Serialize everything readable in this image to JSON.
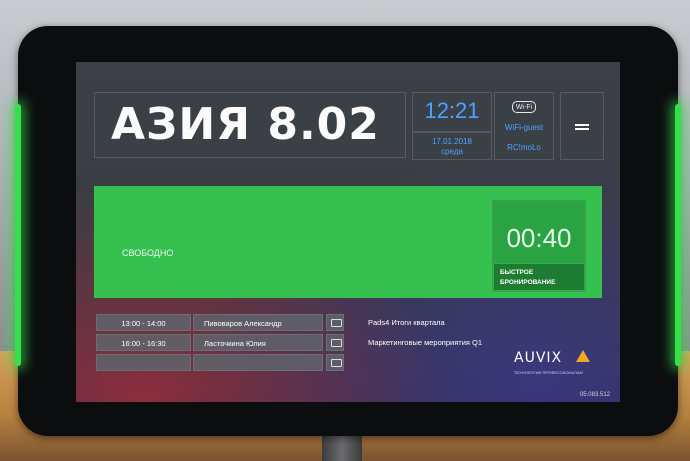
{
  "screen": {
    "room_title": "АЗИЯ 8.02",
    "clock": "12:21",
    "date": "17.01.2018",
    "weekday": "среда",
    "wifi": {
      "icon": "wifi-icon",
      "ssid": "WiFi-guest",
      "password": "RC!moLo"
    },
    "menu_icon": "menu-icon",
    "status": {
      "text": "СВОБОДНО",
      "timer": "00:40",
      "quick_book_line1": "БЫСТРОЕ",
      "quick_book_line2": "БРОНИРОВАНИЕ"
    },
    "meetings": [
      {
        "time": "13:00 - 14:00",
        "person": "Пивоваров Александр",
        "topic": "Pads4 Итоги квартала"
      },
      {
        "time": "16:00 - 16:30",
        "person": "Ласточкина Юлия",
        "topic": "Маркетинговые мероприятия Q1"
      },
      {
        "time": "",
        "person": "",
        "topic": ""
      }
    ],
    "logo": {
      "word": "AUVIX",
      "tagline": "ТЕХНОЛОГИИ ПРОФЕССИОНАЛАМ"
    },
    "room_id": "05.083.512"
  },
  "colors": {
    "status_green": "#36c04f",
    "accent_blue": "#4aa3ff",
    "led_green": "#36e04a",
    "logo_orange": "#f2a623"
  }
}
